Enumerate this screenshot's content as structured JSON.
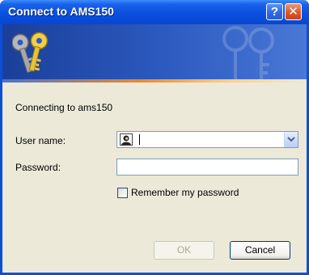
{
  "window": {
    "title": "Connect to AMS150",
    "help_label": "?",
    "close_label": "✕",
    "icon": "keys-icon",
    "watermark_icon": "keys-watermark-icon"
  },
  "dialog": {
    "connecting_text": "Connecting to ams150",
    "username_label": "User name:",
    "username_value": "",
    "username_icon": "user-account-icon",
    "password_label": "Password:",
    "password_value": "",
    "remember_label": "Remember my password",
    "remember_checked": false,
    "ok_label": "OK",
    "ok_enabled": false,
    "cancel_label": "Cancel"
  },
  "colors": {
    "titlebar": "#0a50e0",
    "banner": "#2d5bc0",
    "accent_line": "#e78a34",
    "face": "#ece9d8",
    "close_button": "#d9582a"
  }
}
